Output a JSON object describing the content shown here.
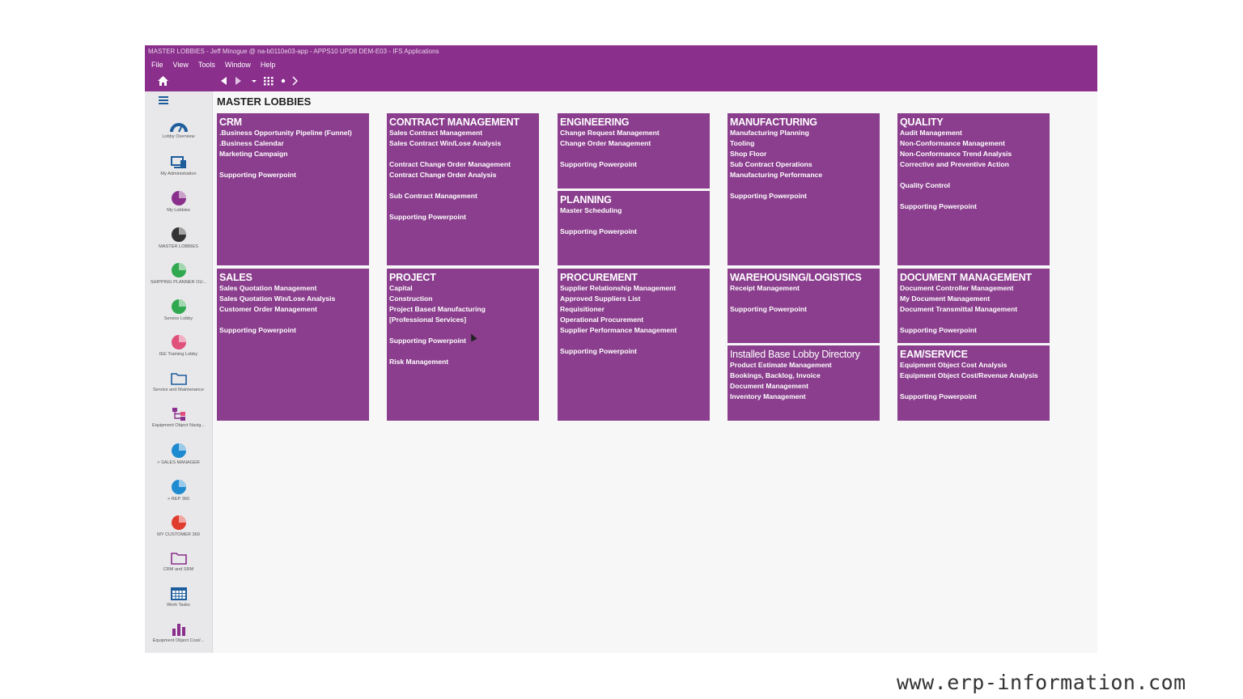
{
  "window": {
    "title": "MASTER LOBBIES - Jeff Minogue @ na-b0110e03-app - APPS10 UPD8 DEM-E03 - IFS Applications",
    "menu": [
      "File",
      "View",
      "Tools",
      "Window",
      "Help"
    ]
  },
  "page_title": "MASTER LOBBIES",
  "sidebar": [
    {
      "label": "Lobby Overview",
      "icon": "gauge-icon",
      "color": "#1e5d9c"
    },
    {
      "label": "My Administration",
      "icon": "monitor-icon",
      "color": "#1e5d9c"
    },
    {
      "label": "My Lobbies",
      "icon": "pie-chart-icon",
      "color": "#8a2f8c"
    },
    {
      "label": "MASTER LOBBIES",
      "icon": "pie-chart-icon",
      "color": "#333333"
    },
    {
      "label": "SHIPPING PLANNER OU...",
      "icon": "pie-chart-icon",
      "color": "#2fa84f"
    },
    {
      "label": "Service Lobby",
      "icon": "pie-chart-icon",
      "color": "#2fa84f"
    },
    {
      "label": "IEE Training Lobby",
      "icon": "pie-chart-icon",
      "color": "#e0507a"
    },
    {
      "label": "Service and Maintenance",
      "icon": "folder-icon",
      "color": "#1e5d9c"
    },
    {
      "label": "Equipment Object Navig...",
      "icon": "tree-icon",
      "color": "#8a2f8c"
    },
    {
      "label": "> SALES MANAGER",
      "icon": "pie-chart-icon",
      "color": "#1e8ad0"
    },
    {
      "label": "> REP 360",
      "icon": "pie-chart-icon",
      "color": "#1e8ad0"
    },
    {
      "label": "MY CUSTOMER 360",
      "icon": "pie-chart-icon",
      "color": "#e03c2e"
    },
    {
      "label": "CRM and SRM",
      "icon": "folder-icon",
      "color": "#8a2f8c"
    },
    {
      "label": "Work Tasks",
      "icon": "calendar-icon",
      "color": "#1e5d9c"
    },
    {
      "label": "Equipment Object Cost/...",
      "icon": "bar-chart-icon",
      "color": "#8a2f8c"
    }
  ],
  "tiles": {
    "crm": {
      "title": "CRM",
      "lines": [
        ".Business Opportunity Pipeline (Funnel)",
        ".Business Calendar",
        "Marketing Campaign",
        "",
        "Supporting Powerpoint"
      ]
    },
    "contract": {
      "title": "CONTRACT MANAGEMENT",
      "lines": [
        "Sales Contract Management",
        "Sales Contract Win/Lose Analysis",
        "",
        "Contract Change Order Management",
        "Contract Change Order Analysis",
        "",
        "Sub Contract Management",
        "",
        "Supporting Powerpoint"
      ]
    },
    "engineering": {
      "title": "ENGINEERING",
      "lines": [
        "Change Request Management",
        "Change Order Management",
        "",
        "Supporting Powerpoint"
      ]
    },
    "planning": {
      "title": "PLANNING",
      "lines": [
        "Master Scheduling",
        "",
        "Supporting Powerpoint"
      ]
    },
    "manufacturing": {
      "title": "MANUFACTURING",
      "lines": [
        "Manufacturing Planning",
        "Tooling",
        "Shop Floor",
        "Sub Contract Operations",
        "Manufacturing Performance",
        "",
        "Supporting Powerpoint"
      ]
    },
    "quality": {
      "title": "QUALITY",
      "lines": [
        "Audit Management",
        "Non-Conformance Management",
        "Non-Conformance Trend Analysis",
        "Corrective and Preventive Action",
        "",
        "Quality Control",
        "",
        "Supporting Powerpoint"
      ]
    },
    "sales": {
      "title": "SALES",
      "lines": [
        "Sales Quotation Management",
        "Sales Quotation Win/Lose Analysis",
        "Customer Order Management",
        "",
        "Supporting Powerpoint"
      ]
    },
    "project": {
      "title": "PROJECT",
      "lines": [
        "Capital",
        "Construction",
        "Project Based Manufacturing",
        "[Professional Services]",
        "",
        "Supporting Powerpoint",
        "",
        "Risk Management"
      ]
    },
    "procurement": {
      "title": "PROCUREMENT",
      "lines": [
        "Supplier Relationship Management",
        "Approved Suppliers List",
        "Requisitioner",
        "Operational Procurement",
        "Supplier Performance Management",
        "",
        "Supporting Powerpoint"
      ]
    },
    "warehousing": {
      "title": "WAREHOUSING/LOGISTICS",
      "lines": [
        "Receipt Management",
        "",
        "Supporting Powerpoint"
      ]
    },
    "installed": {
      "title": "Installed Base Lobby Directory",
      "lines": [
        "Product Estimate Management",
        "Bookings, Backlog, Invoice",
        "Document Management",
        "Inventory Management"
      ]
    },
    "document": {
      "title": "DOCUMENT MANAGEMENT",
      "lines": [
        "Document Controller Management",
        "My Document Management",
        "Document Transmittal Management",
        "",
        "Supporting Powerpoint"
      ]
    },
    "eam": {
      "title": "EAM/SERVICE",
      "lines": [
        "Equipment Object Cost Analysis",
        "Equipment Object Cost/Revenue Analysis",
        "",
        "Supporting Powerpoint"
      ]
    }
  },
  "watermark": "www.erp-information.com"
}
